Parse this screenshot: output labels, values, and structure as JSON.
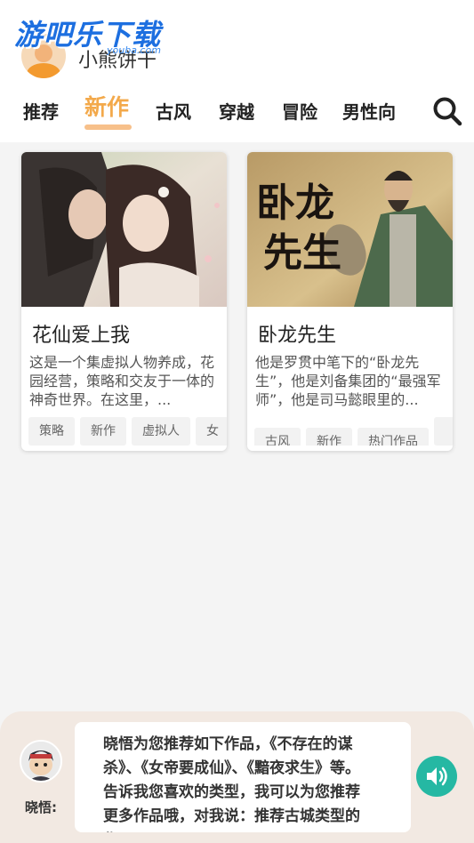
{
  "header": {
    "watermark": "游吧乐下载",
    "app_name": "小熊饼干"
  },
  "tabs": [
    {
      "label": "推荐",
      "active": false
    },
    {
      "label": "新作",
      "active": true
    },
    {
      "label": "古风",
      "active": false
    },
    {
      "label": "穿越",
      "active": false
    },
    {
      "label": "冒险",
      "active": false
    },
    {
      "label": "男性向",
      "active": false
    }
  ],
  "cards": [
    {
      "title": "花仙爱上我",
      "description": "这是一个集虚拟人物养成，花园经营，策略和交友于一体的神奇世界。在这里，...",
      "tags": [
        "策略",
        "新作",
        "虚拟人",
        "女"
      ]
    },
    {
      "title": "卧龙先生",
      "cover_text": "卧龙先生",
      "description": "他是罗贯中笔下的“卧龙先生”，他是刘备集团的“最强军师”，他是司马懿眼里的...",
      "tags": [
        "古风",
        "新作",
        "热门作品",
        ""
      ]
    }
  ],
  "assistant": {
    "name": "晓悟:",
    "message": "晓悟为您推荐如下作品，《不存在的谋杀》、《女帝要成仙》、《黯夜求生》等。告诉我您喜欢的类型，我可以为您推荐更多作品哦，对我说：推荐古城类型的作品"
  },
  "colors": {
    "accent": "#f3a94b",
    "sound_button": "#25b8a3"
  }
}
